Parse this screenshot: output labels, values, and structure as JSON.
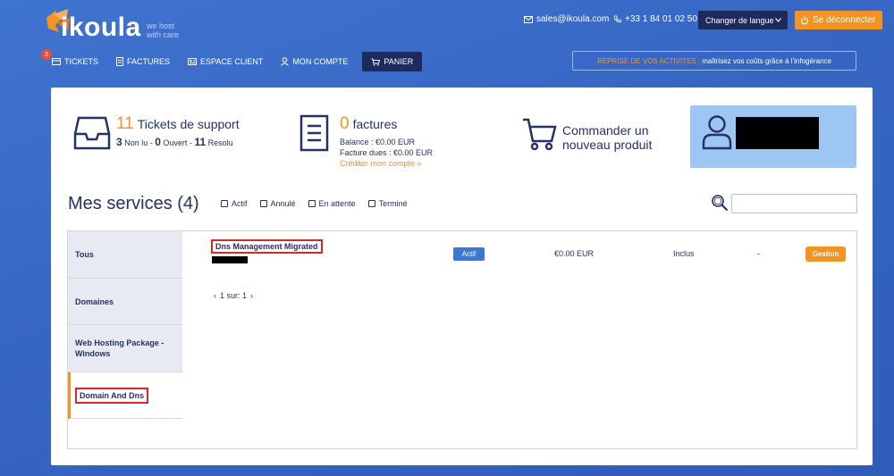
{
  "header": {
    "logo_text": "ikoula",
    "logo_tagline_1": "we host",
    "logo_tagline_2": "with care",
    "email": "sales@ikoula.com",
    "phone": "+33 1 84 01 02 50",
    "language_select": "Changer de langue",
    "logout_label": "Se déconnecter"
  },
  "nav": {
    "tickets_badge": "3",
    "items": [
      {
        "label": "TICKETS",
        "icon": "ticket-icon"
      },
      {
        "label": "FACTURES",
        "icon": "invoice-icon"
      },
      {
        "label": "ESPACE CLIENT",
        "icon": "dashboard-icon"
      },
      {
        "label": "MON COMPTE",
        "icon": "user-icon"
      },
      {
        "label": "PANIER",
        "icon": "cart-icon"
      }
    ]
  },
  "promo": {
    "highlight": "REPRISE DE VOS ACTIVITES :",
    "text": "maîtrisez vos coûts grâce à l'infogérance"
  },
  "stats": {
    "tickets": {
      "count": "11",
      "title": "Tickets de support",
      "unread_count": "3",
      "unread_label": "Non lu",
      "open_count": "0",
      "open_label": "Ouvert",
      "resolved_count": "11",
      "resolved_label": "Resolu"
    },
    "invoices": {
      "count": "0",
      "title": "factures",
      "balance": "Balance : €0.00 EUR",
      "due": "Facture dues : €0.00 EUR",
      "credit_link": "Créditer mon compte »"
    },
    "order": {
      "line1": "Commander un",
      "line2": "nouveau produit"
    }
  },
  "services": {
    "title": "Mes services (4)",
    "filters": [
      "Actif",
      "Annulé",
      "En attente",
      "Terminé"
    ],
    "search_placeholder": "",
    "categories": [
      "Tous",
      "Domaines",
      "Web Hosting Package - Windows",
      "Domain And Dns"
    ],
    "active_category": "Domain And Dns",
    "rows": [
      {
        "name": "Dns Management Migrated",
        "status": "Actif",
        "price": "€0.00 EUR",
        "billing": "Inclus",
        "due": "-",
        "action": "Gestion"
      }
    ],
    "pager": "1 sur: 1"
  },
  "colors": {
    "accent": "#f39322",
    "navy": "#243266",
    "status_blue": "#3a79d6",
    "highlight_red": "#d8262a"
  }
}
